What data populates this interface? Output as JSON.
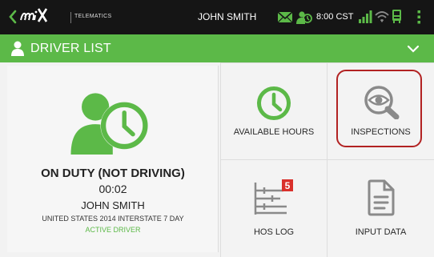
{
  "status_bar": {
    "logo": "mix",
    "logo_sub": "TELEMATICS",
    "user_name": "JOHN SMITH",
    "time": "8:00 CST"
  },
  "header": {
    "title": "DRIVER LIST"
  },
  "driver": {
    "status": "ON DUTY (NOT DRIVING)",
    "timer": "00:02",
    "name": "JOHN SMITH",
    "ruleset": "UNITED STATES 2014 INTERSTATE 7 DAY",
    "role": "ACTIVE DRIVER"
  },
  "tiles": [
    {
      "label": "AVAILABLE HOURS",
      "icon": "clock-icon"
    },
    {
      "label": "INSPECTIONS",
      "icon": "eye-magnifier-icon"
    },
    {
      "label": "HOS LOG",
      "icon": "hos-log-icon",
      "badge": "5"
    },
    {
      "label": "INPUT DATA",
      "icon": "document-icon"
    }
  ],
  "colors": {
    "accent_green": "#5cb948",
    "topbar": "#151515",
    "badge_red": "#d9302b",
    "highlight": "#b22222"
  }
}
